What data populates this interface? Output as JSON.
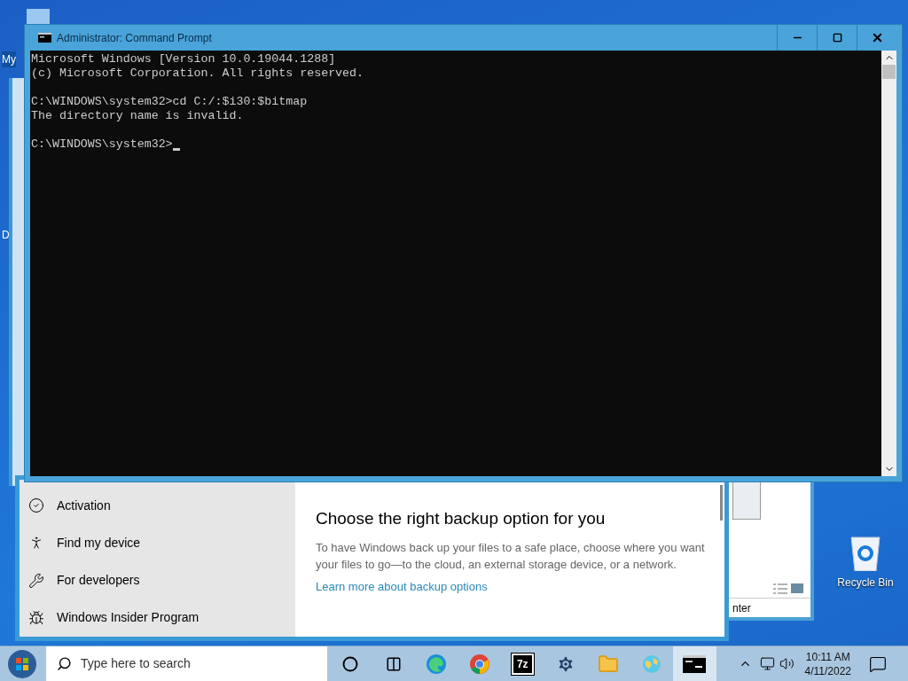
{
  "desktop": {
    "left_icon_labels": [
      "My",
      "D"
    ],
    "recycle_bin": {
      "label": "Recycle Bin"
    }
  },
  "command_prompt": {
    "title": "Administrator: Command Prompt",
    "blocks": [
      [
        "Microsoft Windows [Version 10.0.19044.1288]",
        "(c) Microsoft Corporation. All rights reserved."
      ],
      [
        "C:\\WINDOWS\\system32>cd C:/:$i30:$bitmap",
        "The directory name is invalid."
      ],
      [
        "C:\\WINDOWS\\system32>"
      ]
    ],
    "cursor": true
  },
  "settings": {
    "nav_items": [
      {
        "label": "Activation",
        "kind": "activation"
      },
      {
        "label": "Find my device",
        "kind": "find"
      },
      {
        "label": "For developers",
        "kind": "developers"
      },
      {
        "label": "Windows Insider Program",
        "kind": "insider"
      }
    ],
    "heading": "Choose the right backup option for you",
    "body": "To have Windows back up your files to a safe place, choose where you want your files to go—to the cloud, an external storage device, or a network.",
    "link": "Learn more about backup options"
  },
  "background_window": {
    "status_text": "nter"
  },
  "taskbar": {
    "search_placeholder": "Type here to search",
    "apps": [
      {
        "kind": "cortana",
        "selected": false
      },
      {
        "kind": "taskview",
        "selected": false
      },
      {
        "kind": "edge",
        "selected": false
      },
      {
        "kind": "chrome",
        "selected": false
      },
      {
        "kind": "sevenzip",
        "label": "7z",
        "selected": false
      },
      {
        "kind": "settings",
        "selected": false
      },
      {
        "kind": "explorer",
        "selected": false
      },
      {
        "kind": "globe",
        "selected": false
      },
      {
        "kind": "terminal",
        "selected": true
      }
    ],
    "time": "10:11 AM",
    "date": "4/11/2022"
  }
}
